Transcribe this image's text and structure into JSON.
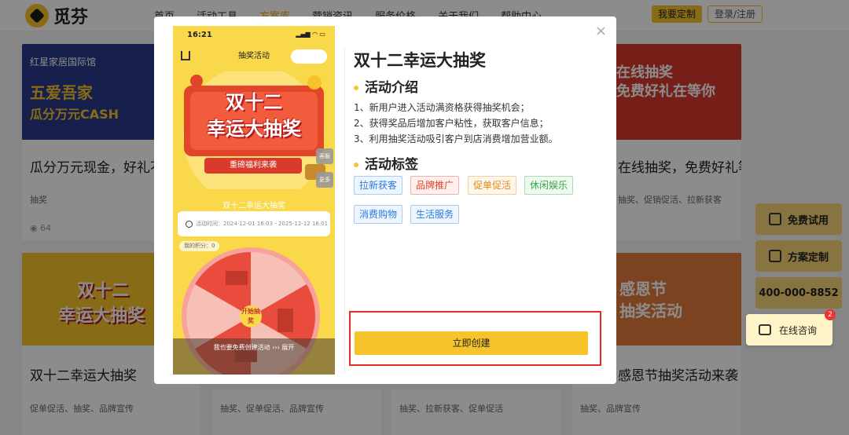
{
  "site": {
    "brand": "觅芬",
    "nav": [
      "首页",
      "活动工具",
      "方案库",
      "营销资讯",
      "服务价格",
      "关于我们",
      "帮助中心"
    ],
    "nav_active": 2,
    "custom_button": "我要定制",
    "login_button": "登录/注册"
  },
  "background_cards": [
    {
      "banner_lines": [
        "红星家居国际馆",
        "五爱吾家",
        "瓜分万元CASH"
      ],
      "title": "瓜分万元现金，好礼不停",
      "tags": "抽奖",
      "views": "64"
    },
    {
      "banner_lines": [
        "在线抽奖",
        "免费好礼在等你"
      ],
      "title": "在线抽奖，免费好礼等你拿",
      "tags": "抽奖、促销促活、拉新获客",
      "views": ""
    },
    {
      "banner_lines": [
        "双十二",
        "幸运大抽奖"
      ],
      "title": "双十二幸运大抽奖",
      "tags": "促单促活、抽奖、品牌宣传",
      "views": ""
    },
    {
      "banner_lines": [
        "感恩节",
        "抽奖活动"
      ],
      "title": "感恩节抽奖活动来袭",
      "tags": "抽奖、品牌宣传",
      "views": ""
    },
    {
      "title": "",
      "tags": "抽奖、促单促活、品牌宣传",
      "views": ""
    },
    {
      "title": "",
      "tags": "抽奖、拉新获客、促单促活",
      "views": ""
    }
  ],
  "side_widgets": {
    "free_trial": "免费试用",
    "custom_plan": "方案定制",
    "phone": "400-000-8852",
    "consult": "在线咨询",
    "consult_badge": "2"
  },
  "modal": {
    "close_symbol": "×",
    "preview": {
      "status_time": "16:21",
      "nav_title": "抽奖活动",
      "banner_line1": "双十二",
      "banner_line2": "幸运大抽奖",
      "ribbon": "重磅福利来袭",
      "side_tag_1": "客服",
      "side_tag_2": "更多",
      "activity_title": "双十二幸运大抽奖",
      "time_label": "活动时间：2024-12-01 16:03 - 2025-12-12 16:01",
      "my_count": "我的积分：0",
      "wheel_center": "开始抽奖",
      "bottom_text": "我也要免费创建活动 ››› 展开"
    },
    "title": "双十二幸运大抽奖",
    "intro_heading": "活动介绍",
    "intro_lines": [
      "1、新用户进入活动满资格获得抽奖机会；",
      "2、获得奖品后增加客户粘性，获取客户信息；",
      "3、利用抽奖活动吸引客户到店消费增加营业额。"
    ],
    "tags_heading": "活动标签",
    "tags": [
      "拉新获客",
      "品牌推广",
      "促单促活",
      "休闲娱乐",
      "消费购物",
      "生活服务"
    ],
    "create_button": "立即创建"
  },
  "colors": {
    "accent": "#f6c42a",
    "highlight_frame": "#e42a2a"
  }
}
